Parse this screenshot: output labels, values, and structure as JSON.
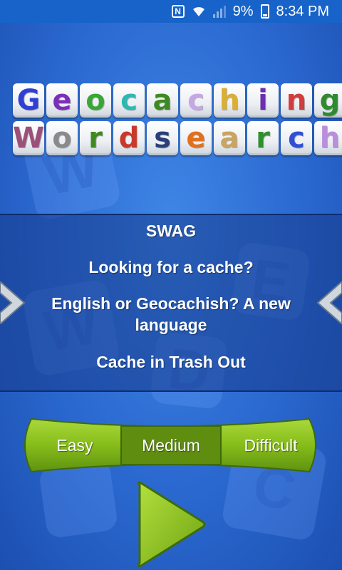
{
  "status_bar": {
    "battery_percent": "9%",
    "time": "8:34 PM",
    "icons": [
      "nfc-icon",
      "wifi-icon",
      "signal-icon",
      "battery-icon"
    ]
  },
  "title": {
    "word1": [
      {
        "letter": "G",
        "color": "#2f3fd6"
      },
      {
        "letter": "e",
        "color": "#7b2fb8"
      },
      {
        "letter": "o",
        "color": "#3aa636"
      },
      {
        "letter": "c",
        "color": "#2fb8b0"
      },
      {
        "letter": "a",
        "color": "#3e8a22"
      },
      {
        "letter": "c",
        "color": "#c7a6e6"
      },
      {
        "letter": "h",
        "color": "#d9b035"
      },
      {
        "letter": "i",
        "color": "#6b2fb0"
      },
      {
        "letter": "n",
        "color": "#d23c3c"
      },
      {
        "letter": "g",
        "color": "#2f8a2f"
      }
    ],
    "word2": [
      {
        "letter": "W",
        "color": "#9c4f7a"
      },
      {
        "letter": "o",
        "color": "#8a8a8a"
      },
      {
        "letter": "r",
        "color": "#3f8a1e"
      },
      {
        "letter": "d",
        "color": "#c8392b"
      },
      {
        "letter": "s",
        "color": "#2a3f7a"
      },
      {
        "letter": "e",
        "color": "#e0701e"
      },
      {
        "letter": "a",
        "color": "#c9a560"
      },
      {
        "letter": "r",
        "color": "#2f8f2f"
      },
      {
        "letter": "c",
        "color": "#2f4fd6"
      },
      {
        "letter": "h",
        "color": "#b98fdc"
      }
    ]
  },
  "facts": [
    "SWAG",
    "Looking for a cache?",
    "English or Geocachish? A new language",
    "Cache in Trash Out"
  ],
  "background_tiles": [
    "W",
    "W",
    "E",
    "D",
    "C"
  ],
  "difficulty": {
    "options": [
      "Easy",
      "Medium",
      "Difficult"
    ],
    "selected": "Medium",
    "color": "#8cc21e",
    "selected_color": "#5e8d10"
  }
}
